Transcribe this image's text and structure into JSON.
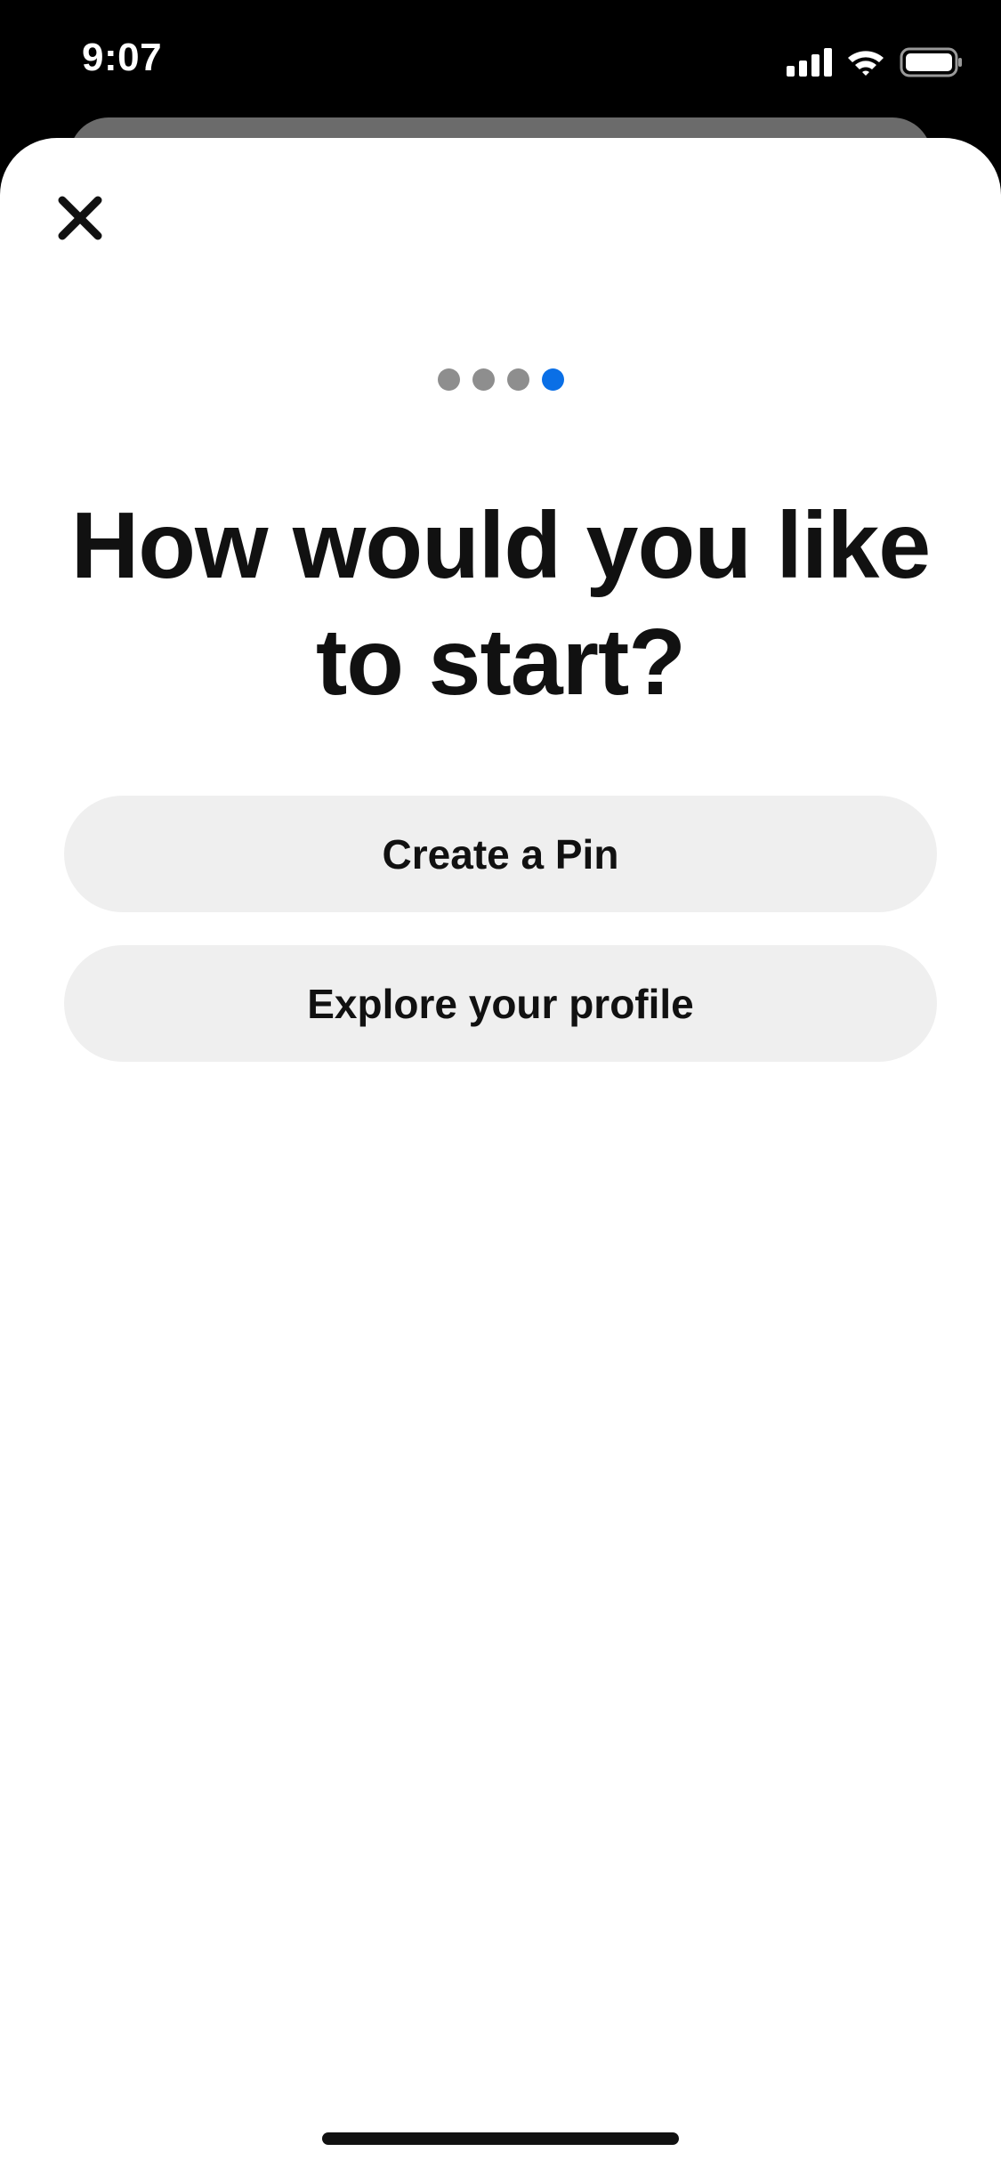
{
  "status_bar": {
    "time": "9:07",
    "icons": [
      "signal-icon",
      "wifi-icon",
      "battery-icon"
    ]
  },
  "sheet": {
    "close_icon": "close-icon",
    "progress": {
      "total_steps": 4,
      "current_step": 4,
      "active_color": "#0a6fe6",
      "inactive_color": "#8e8e8e"
    },
    "title": "How would you like to start?",
    "options": [
      {
        "label": "Create a Pin"
      },
      {
        "label": "Explore your profile"
      }
    ]
  }
}
